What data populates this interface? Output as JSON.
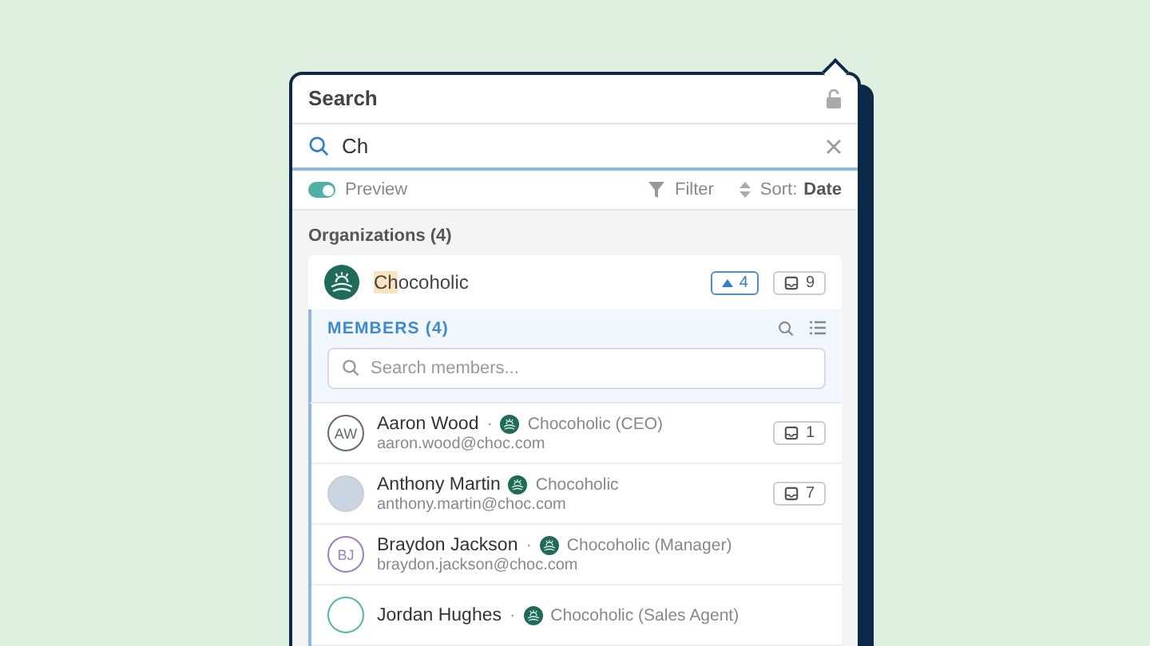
{
  "panel": {
    "title": "Search",
    "locked": false
  },
  "search": {
    "value": "Ch"
  },
  "toolbar": {
    "preview": {
      "label": "Preview",
      "on": true
    },
    "filter": "Filter",
    "sort_label": "Sort:",
    "sort_value": "Date"
  },
  "organizations": {
    "heading": "Organizations (4)",
    "items": [
      {
        "name": "Chocoholic",
        "expanded": true,
        "up_count": "4",
        "inbox_count": "9"
      }
    ]
  },
  "members": {
    "heading": "MEMBERS (4)",
    "placeholder": "Search members...",
    "items": [
      {
        "name": "Aaron Wood",
        "separator": "·",
        "org": "Chocoholic (CEO)",
        "email": "aaron.wood@choc.com",
        "avatar": {
          "kind": "initials",
          "text": "AW",
          "color": "#5f6b73"
        },
        "inbox_count": "1"
      },
      {
        "name": "Anthony Martin",
        "org": "Chocoholic",
        "email": "anthony.martin@choc.com",
        "avatar": {
          "kind": "photo"
        },
        "inbox_count": "7"
      },
      {
        "name": "Braydon Jackson",
        "separator": "·",
        "org": "Chocoholic (Manager)",
        "email": "braydon.jackson@choc.com",
        "avatar": {
          "kind": "initials",
          "text": "BJ",
          "color": "#9b7fc9"
        }
      },
      {
        "name": "Jordan Hughes",
        "separator": "·",
        "org": "Chocoholic (Sales Agent)",
        "avatar": {
          "kind": "ring",
          "color": "#4fb8a8"
        }
      }
    ]
  }
}
